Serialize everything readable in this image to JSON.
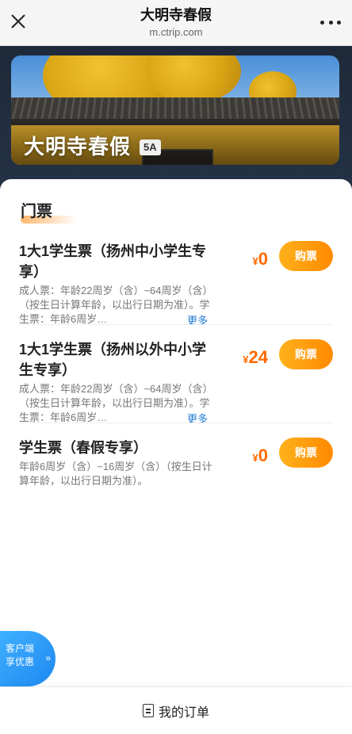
{
  "header": {
    "title": "大明寺春假",
    "domain": "m.ctrip.com"
  },
  "hero": {
    "name": "大明寺春假",
    "badge": "5A"
  },
  "section": {
    "title": "门票"
  },
  "tickets": [
    {
      "name": "1大1学生票（扬州中小学生专享）",
      "currency": "¥",
      "price": "0",
      "buy_label": "购票",
      "desc": "成人票：年龄22周岁（含）~64周岁（含）（按生日计算年龄，以出行日期为准）。学生票：年龄6周岁…",
      "more_label": "更多"
    },
    {
      "name": "1大1学生票（扬州以外中小学生专享）",
      "currency": "¥",
      "price": "24",
      "buy_label": "购票",
      "desc": "成人票：年龄22周岁（含）~64周岁（含）（按生日计算年龄，以出行日期为准）。学生票：年龄6周岁…",
      "more_label": "更多"
    },
    {
      "name": "学生票（春假专享）",
      "currency": "¥",
      "price": "0",
      "buy_label": "购票",
      "desc": "年龄6周岁（含）~16周岁（含）（按生日计算年龄，以出行日期为准）。"
    }
  ],
  "promo": {
    "line1": "客户端",
    "line2": "享优惠",
    "chevron": "»"
  },
  "bottom": {
    "order_label": "我的订单"
  },
  "colors": {
    "accent": "#ff8a00",
    "price": "#ff6a00",
    "link": "#1f7cd6",
    "promo": "#1e88f0"
  }
}
